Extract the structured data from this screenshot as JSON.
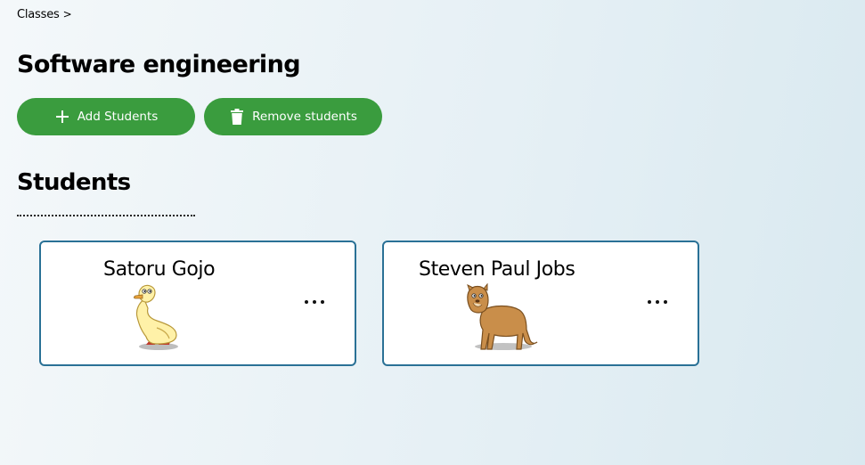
{
  "breadcrumb": {
    "item": "Classes",
    "separator": ">"
  },
  "page": {
    "title": "Software engineering"
  },
  "actions": {
    "add_label": "Add Students",
    "remove_label": "Remove students",
    "add_icon": "plus-icon",
    "remove_icon": "trash-icon",
    "button_color": "#3a9c3e"
  },
  "students_section": {
    "title": "Students"
  },
  "students": [
    {
      "name": "Satoru Gojo",
      "avatar": "duck-avatar"
    },
    {
      "name": "Steven Paul Jobs",
      "avatar": "puma-avatar"
    }
  ],
  "colors": {
    "card_border": "#2a7196"
  }
}
